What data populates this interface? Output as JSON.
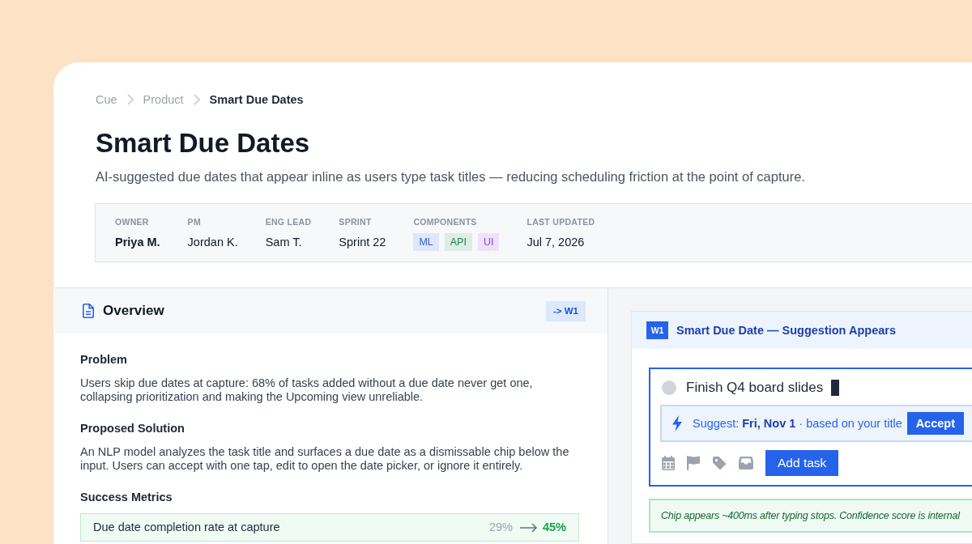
{
  "breadcrumb": [
    {
      "label": "Cue",
      "current": false
    },
    {
      "label": "Product",
      "current": false
    },
    {
      "label": "Smart Due Dates",
      "current": true
    }
  ],
  "title": "Smart Due Dates",
  "subtitle": "AI-suggested due dates that appear inline as users type task titles — reducing scheduling friction at the point of capture.",
  "meta": [
    {
      "kind": "text",
      "label": "OWNER",
      "value": "Priya M.",
      "primary": true
    },
    {
      "kind": "text",
      "label": "PM",
      "value": "Jordan K.",
      "primary": false
    },
    {
      "kind": "text",
      "label": "ENG LEAD",
      "value": "Sam T.",
      "primary": false
    },
    {
      "kind": "text",
      "label": "SPRINT",
      "value": "Sprint 22",
      "primary": false
    },
    {
      "kind": "tags",
      "label": "COMPONENTS",
      "tags": [
        {
          "label": "ML",
          "color": "#2f5fd0"
        },
        {
          "label": "API",
          "color": "#23824f"
        },
        {
          "label": "UI",
          "color": "#8b3fd9"
        }
      ]
    },
    {
      "kind": "text",
      "label": "LAST UPDATED",
      "value": "Jul 7, 2026",
      "primary": false
    }
  ],
  "overview": {
    "title": "Overview",
    "link": "-> W1",
    "sections": [
      {
        "kind": "text",
        "heading": "Problem",
        "body": "Users skip due dates at capture: 68% of tasks added without a due date never get one, collapsing prioritization and making the Upcoming view unreliable."
      },
      {
        "kind": "text",
        "heading": "Proposed Solution",
        "body": "An NLP model analyzes the task title and surfaces a due date as a dismissable chip below the input. Users can accept with one tap, edit to open the date picker, or ignore it entirely."
      },
      {
        "kind": "metrics",
        "heading": "Success Metrics",
        "metrics": [
          {
            "label": "Due date completion rate at capture",
            "baseline": "29%",
            "target": "45%"
          }
        ]
      }
    ]
  },
  "wireframe": {
    "badge": "W1",
    "title": "Smart Due Date — Suggestion Appears",
    "task_field": {
      "value": "Finish Q4 board slides"
    },
    "suggestion": {
      "text": "Suggest: **Fri, Nov 1** · based on your title",
      "action": "Accept"
    },
    "submit": "Add task",
    "note": "Chip appears ~400ms after typing stops. Confidence score is internal"
  }
}
